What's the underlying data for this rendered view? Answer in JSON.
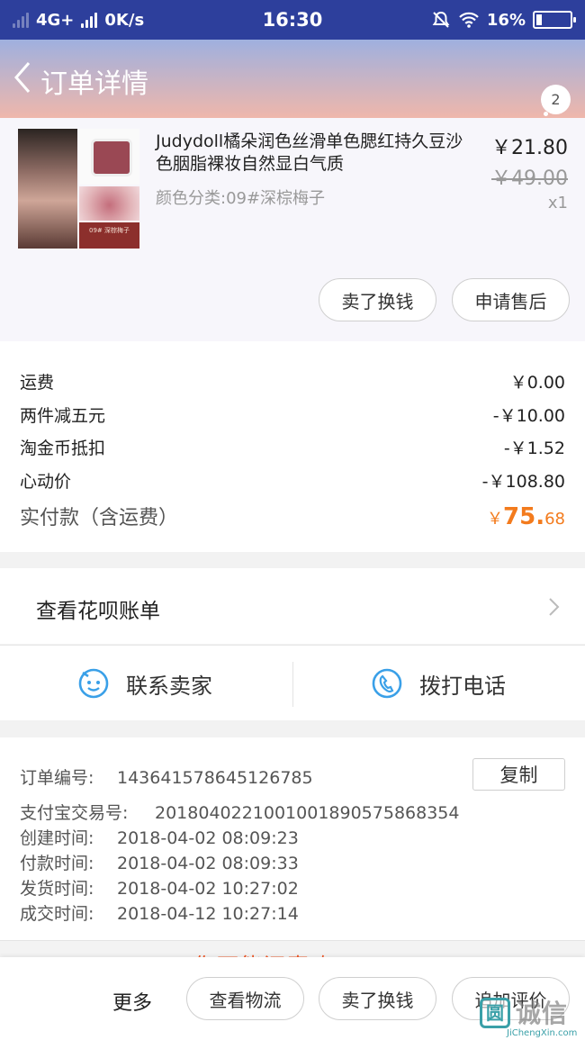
{
  "status_bar": {
    "network": "4G+",
    "speed": "0K/s",
    "time": "16:30",
    "battery": "16%",
    "battery_level": 0.16
  },
  "nav": {
    "title": "订单详情",
    "badge_count": "2"
  },
  "product": {
    "title": "Judydoll橘朵润色丝滑单色腮红持久豆沙色胭脂裸妆自然显白气质",
    "variant": "颜色分类:09#深棕梅子",
    "price": "￥21.80",
    "original_price": "￥49.00",
    "quantity": "x1",
    "box_text": "09# 深棕梅子",
    "buttons": {
      "sell": "卖了换钱",
      "after_sale": "申请售后"
    }
  },
  "costs": {
    "rows": [
      {
        "label": "运费",
        "value": "￥0.00"
      },
      {
        "label": "两件减五元",
        "value": "-￥10.00"
      },
      {
        "label": "淘金币抵扣",
        "value": "-￥1.52"
      },
      {
        "label": "心动价",
        "value": "-￥108.80"
      }
    ],
    "paid_label": "实付款（含运费）",
    "paid_currency": "￥",
    "paid_int": "75.",
    "paid_dec": "68"
  },
  "huabei": {
    "label": "查看花呗账单"
  },
  "contact": {
    "seller": "联系卖家",
    "phone": "拨打电话"
  },
  "order_info": {
    "order_no_label": "订单编号:",
    "order_no": "143641578645126785",
    "copy": "复制",
    "alipay_label": "支付宝交易号:",
    "alipay_no": "2018040221001001890575868354",
    "created_label": "创建时间:",
    "created": "2018-04-02 08:09:23",
    "paid_label": "付款时间:",
    "paid": "2018-04-02 08:09:33",
    "shipped_label": "发货时间:",
    "shipped": "2018-04-02 10:27:02",
    "done_label": "成交时间:",
    "done": "2018-04-12 10:27:14"
  },
  "bottom_bar": {
    "more": "更多",
    "logistics": "查看物流",
    "sell": "卖了换钱",
    "review": "追加评价"
  },
  "watermark": {
    "icon": "圆",
    "text": "诚信",
    "url": "JiChengXin.com"
  },
  "peek_text": "你可能还喜欢",
  "colors": {
    "status_bar": "#2d3f9c",
    "accent_price": "#f37b1d",
    "icon_blue": "#3aa0e8"
  }
}
